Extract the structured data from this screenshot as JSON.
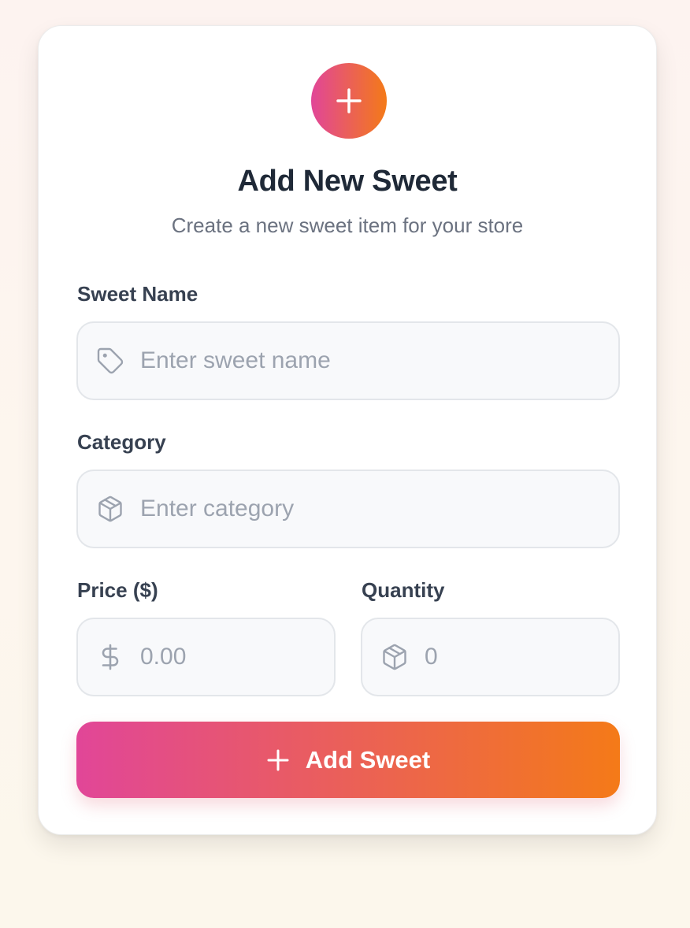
{
  "header": {
    "icon": "plus-icon",
    "title": "Add New Sweet",
    "subtitle": "Create a new sweet item for your store"
  },
  "form": {
    "name": {
      "label": "Sweet Name",
      "placeholder": "Enter sweet name",
      "value": "",
      "icon": "tag-icon"
    },
    "category": {
      "label": "Category",
      "placeholder": "Enter category",
      "value": "",
      "icon": "package-icon"
    },
    "price": {
      "label": "Price ($)",
      "placeholder": "0.00",
      "value": "",
      "icon": "dollar-icon"
    },
    "quantity": {
      "label": "Quantity",
      "placeholder": "0",
      "value": "",
      "icon": "package-icon"
    },
    "submit": {
      "label": "Add Sweet",
      "icon": "plus-icon"
    }
  },
  "colors": {
    "gradient_start": "#e14698",
    "gradient_end": "#f47a18",
    "heading": "#1f2937",
    "muted": "#6b7280",
    "placeholder": "#9ca3af"
  }
}
